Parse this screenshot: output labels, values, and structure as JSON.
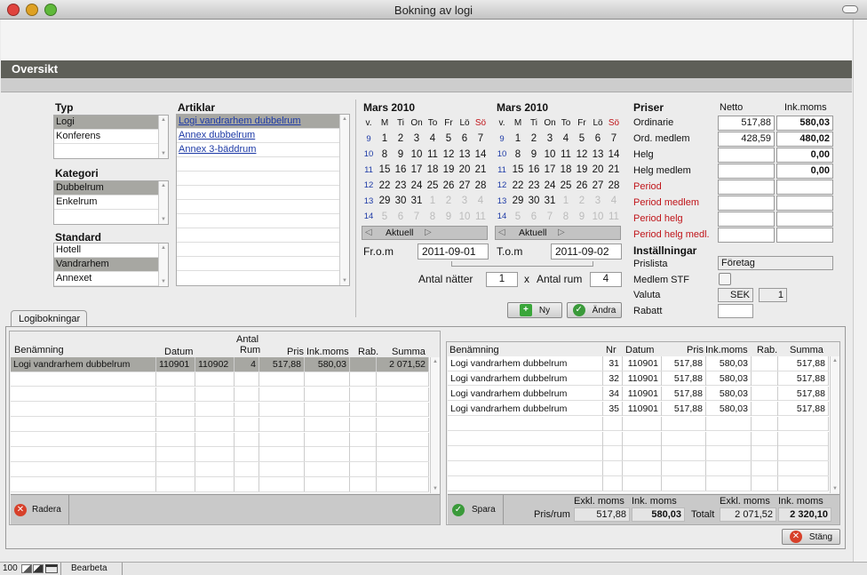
{
  "window": {
    "title": "Bokning av logi"
  },
  "section": {
    "title": "Oversikt"
  },
  "typ": {
    "header": "Typ",
    "items": [
      "Logi",
      "Konferens"
    ]
  },
  "kategori": {
    "header": "Kategori",
    "items": [
      "Dubbelrum",
      "Enkelrum"
    ]
  },
  "standard": {
    "header": "Standard",
    "items": [
      "Hotell",
      "Vandrarhem",
      "Annexet"
    ]
  },
  "artiklar": {
    "header": "Artiklar",
    "items": [
      "Logi vandrarhem dubbelrum",
      "Annex dubbelrum",
      "Annex 3-bäddrum"
    ]
  },
  "calendar_left": {
    "title": "Mars 2010",
    "weekdays": [
      "v.",
      "M",
      "Ti",
      "On",
      "To",
      "Fr",
      "Lö",
      "Sö"
    ],
    "rows": [
      [
        "9",
        "1",
        "2",
        "3",
        "4",
        "5",
        "6",
        "7"
      ],
      [
        "10",
        "8",
        "9",
        "10",
        "11",
        "12",
        "13",
        "14"
      ],
      [
        "11",
        "15",
        "16",
        "17",
        "18",
        "19",
        "20",
        "21"
      ],
      [
        "12",
        "22",
        "23",
        "24",
        "25",
        "26",
        "27",
        "28"
      ],
      [
        "13",
        "29",
        "30",
        "31",
        "1",
        "2",
        "3",
        "4"
      ],
      [
        "14",
        "5",
        "6",
        "7",
        "8",
        "9",
        "10",
        "11"
      ]
    ],
    "nav_label": "Aktuell"
  },
  "calendar_right": {
    "title": "Mars 2010",
    "weekdays": [
      "v.",
      "M",
      "Ti",
      "On",
      "To",
      "Fr",
      "Lö",
      "Sö"
    ],
    "rows": [
      [
        "9",
        "1",
        "2",
        "3",
        "4",
        "5",
        "6",
        "7"
      ],
      [
        "10",
        "8",
        "9",
        "10",
        "11",
        "12",
        "13",
        "14"
      ],
      [
        "11",
        "15",
        "16",
        "17",
        "18",
        "19",
        "20",
        "21"
      ],
      [
        "12",
        "22",
        "23",
        "24",
        "25",
        "26",
        "27",
        "28"
      ],
      [
        "13",
        "29",
        "30",
        "31",
        "1",
        "2",
        "3",
        "4"
      ],
      [
        "14",
        "5",
        "6",
        "7",
        "8",
        "9",
        "10",
        "11"
      ]
    ],
    "nav_label": "Aktuell"
  },
  "dates": {
    "from_label": "Fr.o.m",
    "from_value": "2011-09-01",
    "to_label": "T.o.m",
    "to_value": "2011-09-02",
    "nights_label": "Antal nätter",
    "nights_value": "1",
    "x_label": "x",
    "rooms_label": "Antal rum",
    "rooms_value": "4"
  },
  "buttons": {
    "ny": "Ny",
    "andra": "Ändra",
    "radera": "Radera",
    "spara": "Spara",
    "stang": "Stäng"
  },
  "priser": {
    "header": "Priser",
    "col_netto": "Netto",
    "col_inkmoms": "Ink.moms",
    "rows": [
      {
        "label": "Ordinarie",
        "netto": "517,88",
        "ink": "580,03",
        "red": false
      },
      {
        "label": "Ord. medlem",
        "netto": "428,59",
        "ink": "480,02",
        "red": false
      },
      {
        "label": "Helg",
        "netto": "",
        "ink": "0,00",
        "red": false
      },
      {
        "label": "Helg medlem",
        "netto": "",
        "ink": "0,00",
        "red": false
      },
      {
        "label": "Period",
        "netto": "",
        "ink": "",
        "red": true
      },
      {
        "label": "Period medlem",
        "netto": "",
        "ink": "",
        "red": true
      },
      {
        "label": "Period helg",
        "netto": "",
        "ink": "",
        "red": true
      },
      {
        "label": "Period helg medl.",
        "netto": "",
        "ink": "",
        "red": true
      }
    ]
  },
  "installningar": {
    "header": "Inställningar",
    "prislista_label": "Prislista",
    "prislista_value": "Företag",
    "medlem_label": "Medlem STF",
    "valuta_label": "Valuta",
    "valuta_value": "SEK",
    "valuta_num": "1",
    "rabatt_label": "Rabatt"
  },
  "tab": {
    "label": "Logibokningar"
  },
  "left_table": {
    "headers": {
      "benamning": "Benämning",
      "datum": "Datum",
      "antal": "Antal",
      "rum": "Rum",
      "pris": "Pris",
      "inkmoms": "Ink.moms",
      "rab": "Rab.",
      "summa": "Summa"
    },
    "rows": [
      {
        "benamning": "Logi vandrarhem dubbelrum",
        "from": "110901",
        "to": "110902",
        "rum": "4",
        "pris": "517,88",
        "inkmoms": "580,03",
        "rab": "",
        "summa": "2 071,52"
      }
    ]
  },
  "right_table": {
    "headers": {
      "benamning": "Benämning",
      "nr": "Nr",
      "datum": "Datum",
      "pris": "Pris",
      "inkmoms": "Ink.moms",
      "rab": "Rab.",
      "summa": "Summa"
    },
    "rows": [
      {
        "benamning": "Logi vandrarhem dubbelrum",
        "nr": "31",
        "datum": "110901",
        "pris": "517,88",
        "inkmoms": "580,03",
        "rab": "",
        "summa": "517,88"
      },
      {
        "benamning": "Logi vandrarhem dubbelrum",
        "nr": "32",
        "datum": "110901",
        "pris": "517,88",
        "inkmoms": "580,03",
        "rab": "",
        "summa": "517,88"
      },
      {
        "benamning": "Logi vandrarhem dubbelrum",
        "nr": "34",
        "datum": "110901",
        "pris": "517,88",
        "inkmoms": "580,03",
        "rab": "",
        "summa": "517,88"
      },
      {
        "benamning": "Logi vandrarhem dubbelrum",
        "nr": "35",
        "datum": "110901",
        "pris": "517,88",
        "inkmoms": "580,03",
        "rab": "",
        "summa": "517,88"
      }
    ]
  },
  "totals": {
    "exkl_label": "Exkl. moms",
    "ink_label": "Ink. moms",
    "exkl_label2": "Exkl. moms",
    "ink_label2": "Ink. moms",
    "prisrum_label": "Pris/rum",
    "prisrum_exkl": "517,88",
    "prisrum_ink": "580,03",
    "totalt_label": "Totalt",
    "totalt_exkl": "2 071,52",
    "totalt_ink": "2 320,10"
  },
  "status": {
    "zoom": "100",
    "mode": "Bearbeta"
  },
  "colors": {
    "header_bar": "#5e5f58",
    "selected_row": "#a7a7a2",
    "red_label": "#c0151a",
    "week_blue": "#1d3aa6"
  }
}
